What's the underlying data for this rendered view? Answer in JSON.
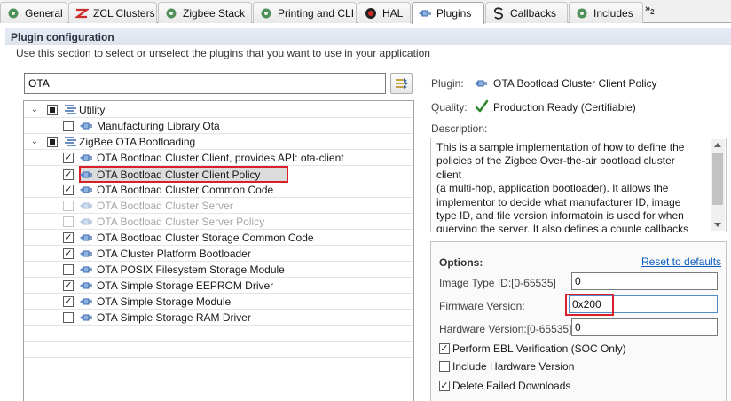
{
  "tabs": [
    {
      "label": "General",
      "icon": "general-tab-icon"
    },
    {
      "label": "ZCL Clusters",
      "icon": "zcl-clusters-tab-icon"
    },
    {
      "label": "Zigbee Stack",
      "icon": "zigbee-stack-tab-icon"
    },
    {
      "label": "Printing and CLI",
      "icon": "printing-cli-tab-icon"
    },
    {
      "label": "HAL",
      "icon": "hal-tab-icon"
    },
    {
      "label": "Plugins",
      "icon": "plugins-tab-icon",
      "active": true
    },
    {
      "label": "Callbacks",
      "icon": "callbacks-tab-icon"
    },
    {
      "label": "Includes",
      "icon": "includes-tab-icon"
    }
  ],
  "tab_overflow": {
    "chevron": "»",
    "count": "2"
  },
  "section": {
    "title": "Plugin configuration",
    "description": "Use this section to select or unselect the plugins that you want to use in your application"
  },
  "filter": {
    "value": "OTA"
  },
  "tree": [
    {
      "label": "Utility",
      "kind": "group",
      "check": "partial"
    },
    {
      "label": "Manufacturing Library Ota",
      "kind": "item",
      "check": "unchecked"
    },
    {
      "label": "ZigBee OTA Bootloading",
      "kind": "group",
      "check": "partial"
    },
    {
      "label": "OTA Bootload Cluster Client, provides API: ota-client",
      "kind": "item",
      "check": "checked"
    },
    {
      "label": "OTA Bootload Cluster Client Policy",
      "kind": "item",
      "check": "checked",
      "selected": true
    },
    {
      "label": "OTA Bootload Cluster Common Code",
      "kind": "item",
      "check": "checked"
    },
    {
      "label": "OTA Bootload Cluster Server",
      "kind": "item",
      "check": "disabled"
    },
    {
      "label": "OTA Bootload Cluster Server Policy",
      "kind": "item",
      "check": "disabled"
    },
    {
      "label": "OTA Bootload Cluster Storage Common Code",
      "kind": "item",
      "check": "checked"
    },
    {
      "label": "OTA Cluster Platform Bootloader",
      "kind": "item",
      "check": "checked"
    },
    {
      "label": "OTA POSIX Filesystem Storage Module",
      "kind": "item",
      "check": "unchecked"
    },
    {
      "label": "OTA Simple Storage EEPROM Driver",
      "kind": "item",
      "check": "checked"
    },
    {
      "label": "OTA Simple Storage Module",
      "kind": "item",
      "check": "checked"
    },
    {
      "label": "OTA Simple Storage RAM Driver",
      "kind": "item",
      "check": "unchecked"
    }
  ],
  "details": {
    "plugin_label": "Plugin:",
    "plugin_name": "OTA Bootload Cluster Client Policy",
    "quality_label": "Quality:",
    "quality_value": "Production Ready (Certifiable)",
    "description_label": "Description:",
    "description_lines": [
      "This is a sample implementation of how to define the",
      "policies of the Zigbee Over-the-air bootload cluster client",
      "(a multi-hop, application bootloader).  It allows the",
      "implementor to decide what manufacturer ID, image",
      "type ID, and file version informatoin is used for when",
      "querying the server.  It also defines a couple callbacks"
    ]
  },
  "options": {
    "title": "Options:",
    "reset_label": "Reset to defaults",
    "fields": [
      {
        "label": "Image Type ID:[0-65535]",
        "value": "0"
      },
      {
        "label": "Firmware Version:",
        "value": "0x200"
      },
      {
        "label": "Hardware Version:[0-65535]",
        "value": "0"
      }
    ],
    "checks": [
      {
        "label": "Perform EBL Verification (SOC Only)",
        "checked": true
      },
      {
        "label": "Include Hardware Version",
        "checked": false
      },
      {
        "label": "Delete Failed Downloads",
        "checked": true
      }
    ]
  },
  "colors": {
    "highlight_border": "#d9202a",
    "link": "#0b5bbf",
    "quality_check": "#2f8a2f"
  }
}
